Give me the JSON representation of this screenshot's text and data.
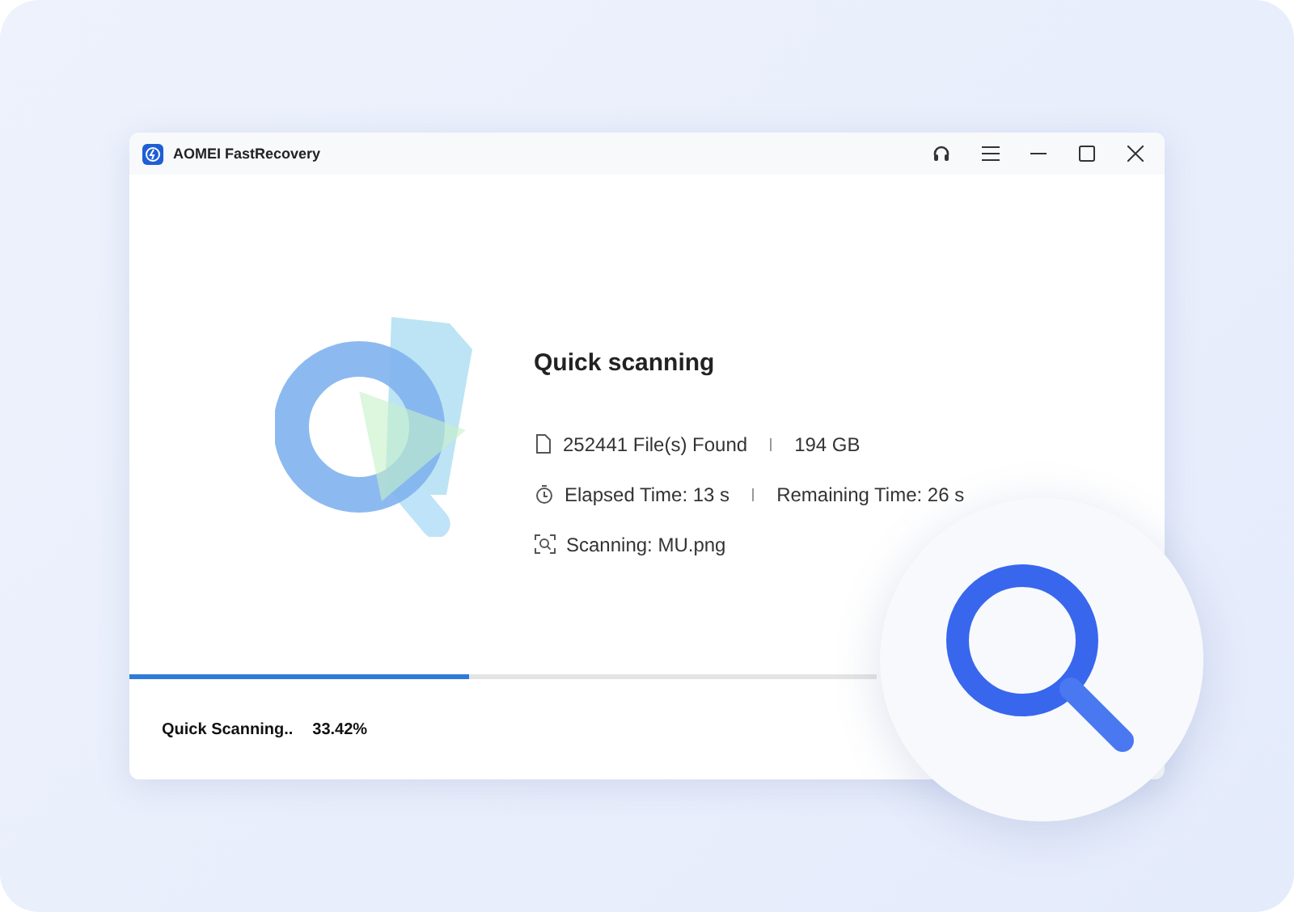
{
  "window": {
    "title": "AOMEI FastRecovery"
  },
  "scan": {
    "title": "Quick scanning",
    "stats": [
      {
        "kind": "files",
        "parts": [
          "252441 File(s) Found",
          "194 GB"
        ]
      },
      {
        "kind": "time",
        "parts": [
          "Elapsed Time:  13 s",
          "Remaining Time:  26 s"
        ]
      },
      {
        "kind": "scanning",
        "parts": [
          "Scanning:  MU.png"
        ]
      }
    ]
  },
  "progress": {
    "level": 0.455,
    "label": "Quick Scanning..",
    "percent": "33.42%"
  }
}
